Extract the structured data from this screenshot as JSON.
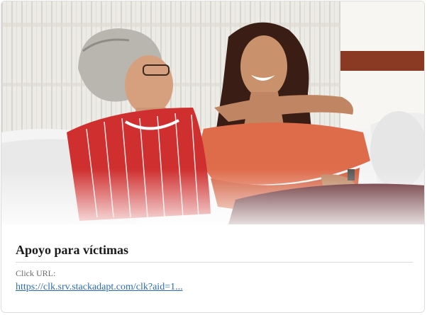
{
  "ad": {
    "title": "Apoyo para víctimas",
    "url_label": "Click URL:",
    "url": "https://clk.srv.stackadapt.com/clk?aid=1..."
  },
  "image": {
    "subject": "older woman and young woman laughing on a white sofa"
  },
  "colors": {
    "title": "#1a1a1a",
    "label": "#6b6b6b",
    "link": "#2a6db5",
    "border": "#dcdcdc"
  }
}
